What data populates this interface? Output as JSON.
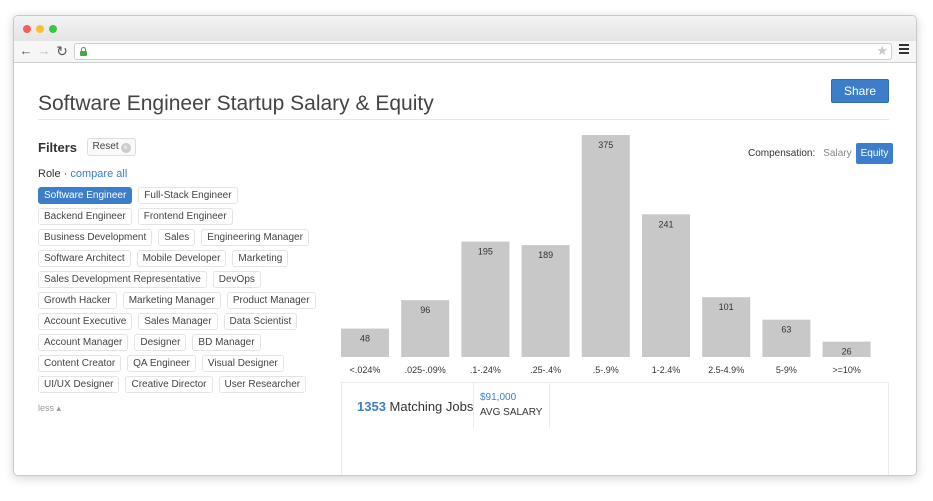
{
  "page": {
    "title": "Software Engineer Startup Salary & Equity",
    "share_label": "Share"
  },
  "filters": {
    "title": "Filters",
    "reset_label": "Reset",
    "role_label": "Role",
    "role_sep": " · ",
    "compare_all": "compare all",
    "less_label": "less",
    "tag_rows": [
      [
        "Software Engineer",
        "Full-Stack Engineer"
      ],
      [
        "Backend Engineer",
        "Frontend Engineer"
      ],
      [
        "Business Development",
        "Sales",
        "Engineering Manager"
      ],
      [
        "Software Architect",
        "Mobile Developer",
        "Marketing"
      ],
      [
        "Sales Development Representative",
        "DevOps"
      ],
      [
        "Growth Hacker",
        "Marketing Manager",
        "Product Manager"
      ],
      [
        "Account Executive",
        "Sales Manager",
        "Data Scientist"
      ],
      [
        "Account Manager",
        "Designer",
        "BD Manager"
      ],
      [
        "Content Creator",
        "QA Engineer",
        "Visual Designer"
      ],
      [
        "UI/UX Designer",
        "Creative Director",
        "User Researcher"
      ]
    ],
    "active_tag": "Software Engineer"
  },
  "compensation": {
    "label": "Compensation:",
    "options": [
      "Salary",
      "Equity"
    ],
    "selected": "Equity"
  },
  "chart_data": {
    "type": "bar",
    "categories": [
      "<.024%",
      ".025-.09%",
      ".1-.24%",
      ".25-.4%",
      ".5-.9%",
      "1-2.4%",
      "2.5-4.9%",
      "5-9%",
      ">=10%"
    ],
    "values": [
      48,
      96,
      195,
      189,
      375,
      241,
      101,
      63,
      26
    ],
    "ylim": [
      0,
      375
    ],
    "bar_color": "#c8c8c8"
  },
  "stats": {
    "jobs_count": "1353",
    "jobs_label": " Matching Jobs",
    "avg_salary_value": "$91,000",
    "avg_salary_label": "AVG SALARY"
  },
  "colors": {
    "accent": "#3c7ec9"
  }
}
